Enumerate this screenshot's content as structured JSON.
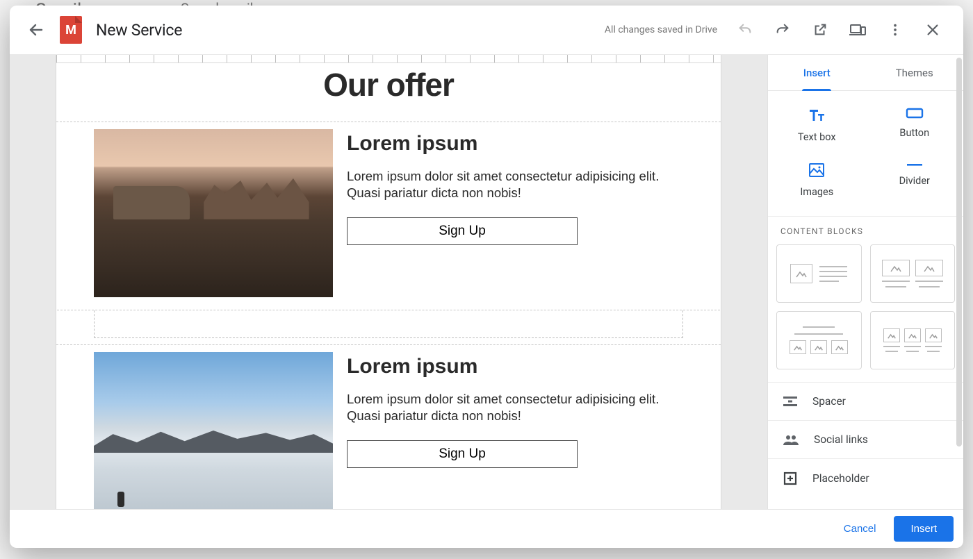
{
  "bg": {
    "app": "Gmail",
    "search": "Search mail"
  },
  "header": {
    "title": "New Service",
    "save_status": "All changes saved in Drive"
  },
  "canvas": {
    "title": "Our offer",
    "blocks": [
      {
        "heading": "Lorem ipsum",
        "body": "Lorem ipsum dolor sit amet consectetur adipisicing elit. Quasi pariatur dicta non nobis!",
        "button": "Sign Up"
      },
      {
        "heading": "Lorem ipsum",
        "body": "Lorem ipsum dolor sit amet consectetur adipisicing elit. Quasi pariatur dicta non nobis!",
        "button": "Sign Up"
      }
    ]
  },
  "panel": {
    "tabs": {
      "insert": "Insert",
      "themes": "Themes"
    },
    "tools": {
      "textbox": "Text box",
      "button": "Button",
      "images": "Images",
      "divider": "Divider"
    },
    "content_blocks_label": "CONTENT BLOCKS",
    "rows": {
      "spacer": "Spacer",
      "social": "Social links",
      "placeholder": "Placeholder"
    }
  },
  "footer": {
    "cancel": "Cancel",
    "insert": "Insert"
  }
}
